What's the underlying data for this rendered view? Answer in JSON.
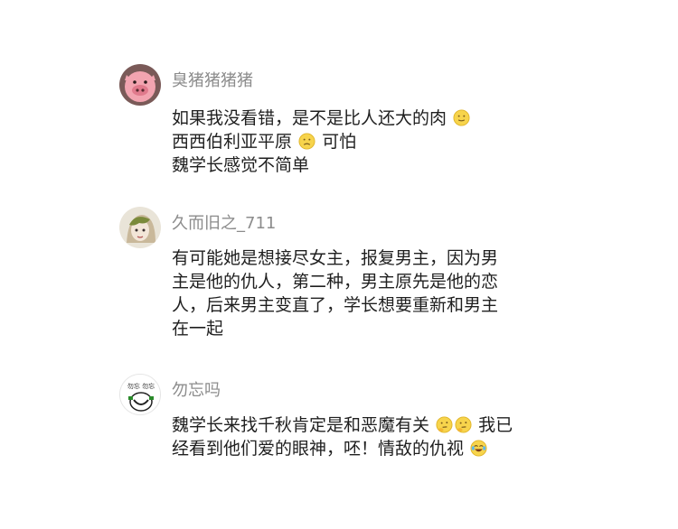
{
  "comments": [
    {
      "username": "臭猪猪猪猪",
      "lines": [
        [
          "如果我没看错，是不是比人还大的肉",
          "🙂"
        ],
        [
          "西西伯利亚平原",
          "😟",
          "可怕"
        ],
        [
          "魏学长感觉不简单"
        ]
      ]
    },
    {
      "username": "久而旧之_711",
      "lines": [
        [
          "有可能她是想接尽女主，报复男主，因为男"
        ],
        [
          "主是他的仇人，第二种，男主原先是他的恋"
        ],
        [
          "人，后来男主变直了，学长想要重新和男主"
        ],
        [
          "在一起"
        ]
      ]
    },
    {
      "username": "勿忘吗",
      "avatar_text": "勿忘 勿忘",
      "lines": [
        [
          "魏学长来找千秋肯定是和恶魔有关",
          "🤔",
          "🤔",
          "我已"
        ],
        [
          "经看到他们爱的眼神，呸！情敌的仇视",
          "😂"
        ]
      ]
    }
  ]
}
